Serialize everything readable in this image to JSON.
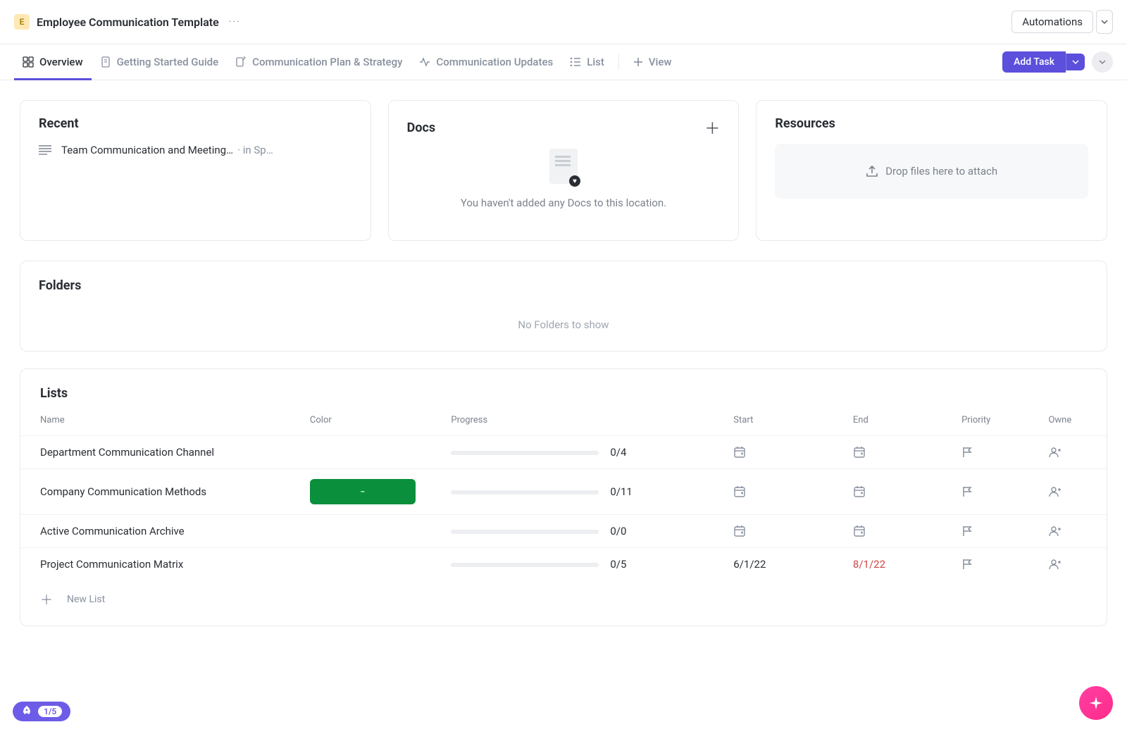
{
  "header": {
    "badge_letter": "E",
    "title": "Employee Communication Template",
    "automations_label": "Automations"
  },
  "tabs": {
    "overview": "Overview",
    "getting_started": "Getting Started Guide",
    "plan_strategy": "Communication Plan & Strategy",
    "updates": "Communication Updates",
    "list": "List",
    "view": "View",
    "add_task": "Add Task"
  },
  "recent": {
    "title": "Recent",
    "item_title": "Team Communication and Meeting…",
    "item_meta": " · in Sp…"
  },
  "docs": {
    "title": "Docs",
    "empty_message": "You haven't added any Docs to this location."
  },
  "resources": {
    "title": "Resources",
    "drop_text": "Drop files here to attach"
  },
  "folders": {
    "title": "Folders",
    "empty": "No Folders to show"
  },
  "lists": {
    "title": "Lists",
    "columns": {
      "name": "Name",
      "color": "Color",
      "progress": "Progress",
      "start": "Start",
      "end": "End",
      "priority": "Priority",
      "owner": "Owne"
    },
    "rows": [
      {
        "name": "Department Communication Channel",
        "color_pill": "",
        "progress": "0/4",
        "start": "",
        "end": "",
        "end_red": false
      },
      {
        "name": "Company Communication Methods",
        "color_pill": "-",
        "progress": "0/11",
        "start": "",
        "end": "",
        "end_red": false
      },
      {
        "name": "Active Communication Archive",
        "color_pill": "",
        "progress": "0/0",
        "start": "",
        "end": "",
        "end_red": false
      },
      {
        "name": "Project Communication Matrix",
        "color_pill": "",
        "progress": "0/5",
        "start": "6/1/22",
        "end": "8/1/22",
        "end_red": true
      }
    ],
    "new_list_label": "New List"
  },
  "onboarding": {
    "progress": "1/5"
  }
}
